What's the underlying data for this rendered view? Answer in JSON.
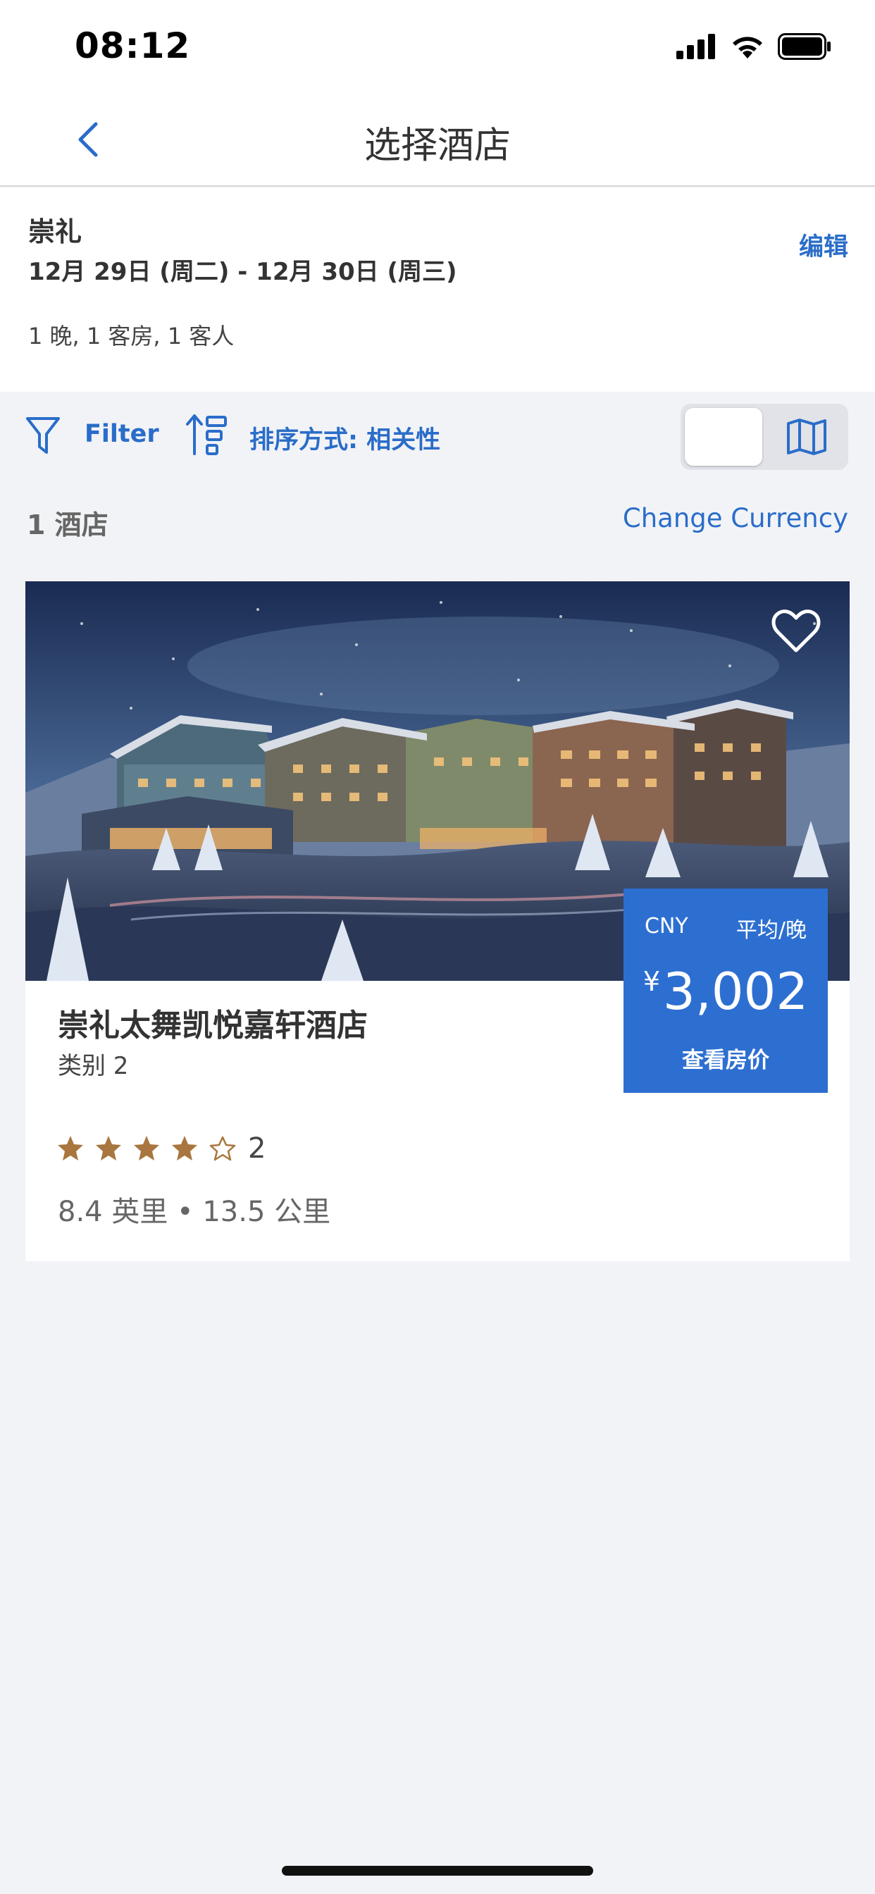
{
  "status_bar": {
    "time": "08:12"
  },
  "nav": {
    "title": "选择酒店"
  },
  "summary": {
    "city": "崇礼",
    "dates": "12月 29日 (周二) - 12月 30日 (周三)",
    "guests": "1 晚, 1 客房, 1 客人",
    "edit_label": "编辑"
  },
  "toolbar": {
    "filter_label": "Filter",
    "sort_label": "排序方式: 相关性",
    "view_mode": "list"
  },
  "results": {
    "count_label": "1 酒店",
    "change_currency_label": "Change Currency"
  },
  "hotel": {
    "name": "崇礼太舞凯悦嘉轩酒店",
    "category": "类别 2",
    "rating_stars": 4,
    "rating_max": 5,
    "rating_count": "2",
    "distance": "8.4 英里 • 13.5 公里",
    "price": {
      "currency": "CNY",
      "unit": "平均/晚",
      "symbol": "¥",
      "amount": "3,002",
      "cta": "查看房价"
    }
  },
  "colors": {
    "accent": "#2a6dc9",
    "price_box": "#2d6fd1",
    "star": "#a8763e",
    "background": "#f2f3f7"
  }
}
